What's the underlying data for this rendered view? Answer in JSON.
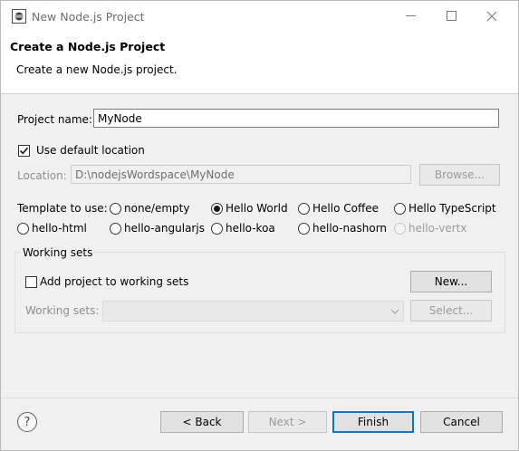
{
  "window": {
    "title": "New Node.js Project"
  },
  "header": {
    "title": "Create a Node.js Project",
    "description": "Create a new Node.js project."
  },
  "project": {
    "name_label": "Project name:",
    "name_value": "MyNode"
  },
  "location": {
    "use_default_label": "Use default location",
    "use_default_checked": true,
    "location_label": "Location:",
    "location_value": "D:\\nodejsWordspace\\MyNode",
    "browse_label": "Browse..."
  },
  "template": {
    "label": "Template to use:",
    "selected": "Hello World",
    "options": [
      {
        "label": "none/empty",
        "checked": false,
        "enabled": true
      },
      {
        "label": "Hello World",
        "checked": true,
        "enabled": true
      },
      {
        "label": "Hello Coffee",
        "checked": false,
        "enabled": true
      },
      {
        "label": "Hello TypeScript",
        "checked": false,
        "enabled": true
      },
      {
        "label": "hello-html",
        "checked": false,
        "enabled": true
      },
      {
        "label": "hello-angularjs",
        "checked": false,
        "enabled": true
      },
      {
        "label": "hello-koa",
        "checked": false,
        "enabled": true
      },
      {
        "label": "hello-nashorn",
        "checked": false,
        "enabled": true
      },
      {
        "label": "hello-vertx",
        "checked": false,
        "enabled": false
      }
    ]
  },
  "working_sets": {
    "group_label": "Working sets",
    "add_label": "Add project to working sets",
    "add_checked": false,
    "new_label": "New...",
    "sets_label": "Working sets:",
    "sets_value": "",
    "select_label": "Select..."
  },
  "footer": {
    "help_icon": "?",
    "back_label": "< Back",
    "next_label": "Next >",
    "finish_label": "Finish",
    "cancel_label": "Cancel"
  },
  "colors": {
    "accent": "#0078d7",
    "dialog_bg": "#f0f0f0",
    "disabled_text": "#9b9b9b"
  }
}
